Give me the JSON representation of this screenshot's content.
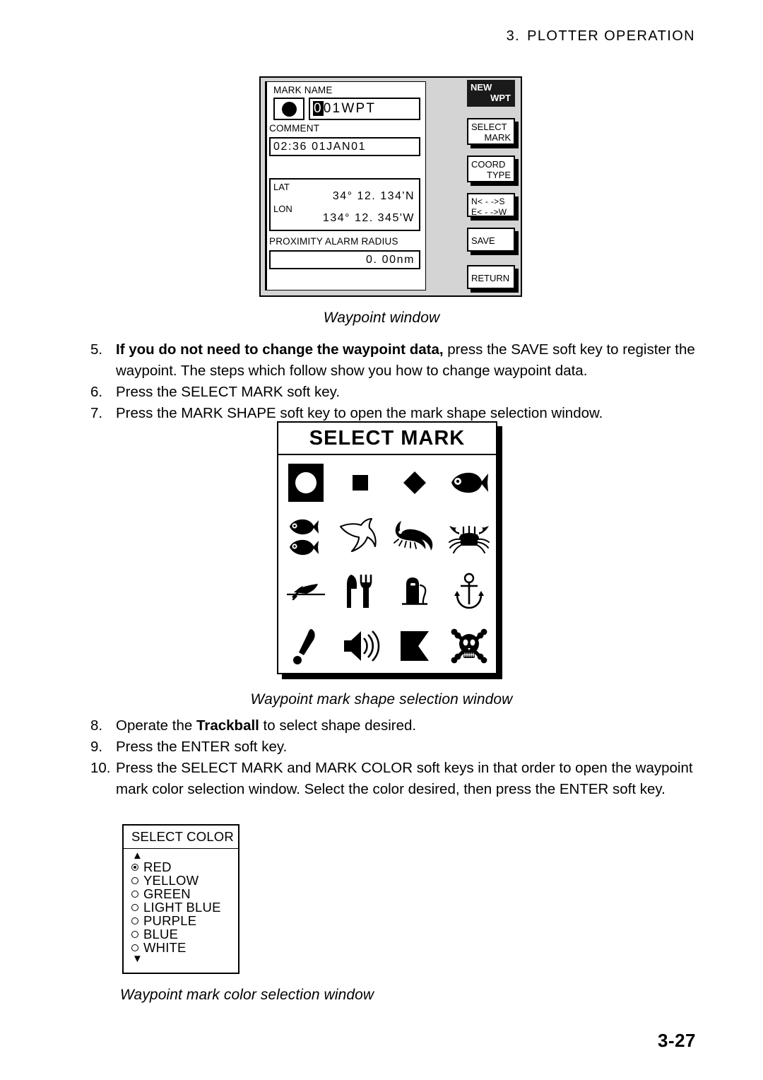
{
  "header": {
    "chapter": "3.",
    "title": "PLOTTER  OPERATION"
  },
  "page_number": "3-27",
  "waypoint_window": {
    "fields": {
      "mark_name_label": "MARK NAME",
      "mark_name_cursor_char": "0",
      "mark_name_rest": "01WPT",
      "mark_icon": "filled-circle-icon",
      "comment_label": "COMMENT",
      "comment_value": "02:36 01JAN01",
      "lat_label": "LAT",
      "lat_value": "34° 12. 134'N",
      "lon_label": "LON",
      "lon_value": "134° 12. 345'W",
      "proximity_label": "PROXIMITY ALARM RADIUS",
      "proximity_value": "0. 00nm"
    },
    "soft_keys": {
      "title_line1": "NEW",
      "title_line2": "WPT",
      "key1_line1": "SELECT",
      "key1_line2": "MARK",
      "key2_line1": "COORD",
      "key2_line2": "TYPE",
      "key3_line1": "N< - ->S",
      "key3_line2": "E< - ->W",
      "key4": "SAVE",
      "key5": "RETURN"
    },
    "caption": "Waypoint window"
  },
  "steps_a": [
    {
      "num": "5.",
      "bold": "If you do not need to change the waypoint data,",
      "text": " press the SAVE soft key to register the waypoint. The steps which follow show you how to change waypoint data."
    },
    {
      "num": "6.",
      "bold": "",
      "text": "Press the SELECT MARK soft key."
    },
    {
      "num": "7.",
      "bold": "",
      "text": "Press the MARK SHAPE soft key to open the mark shape selection window."
    }
  ],
  "select_mark_window": {
    "title": "SELECT MARK",
    "caption": "Waypoint mark shape selection window",
    "marks": [
      {
        "name": "circle-mark-icon",
        "selected": true
      },
      {
        "name": "square-mark-icon",
        "selected": false
      },
      {
        "name": "diamond-mark-icon",
        "selected": false
      },
      {
        "name": "fish-mark-icon",
        "selected": false
      },
      {
        "name": "two-fish-mark-icon",
        "selected": false
      },
      {
        "name": "dolphin-mark-icon",
        "selected": false
      },
      {
        "name": "shrimp-mark-icon",
        "selected": false
      },
      {
        "name": "crab-mark-icon",
        "selected": false
      },
      {
        "name": "wreck-mark-icon",
        "selected": false
      },
      {
        "name": "restaurant-mark-icon",
        "selected": false
      },
      {
        "name": "fuel-pump-mark-icon",
        "selected": false
      },
      {
        "name": "anchor-mark-icon",
        "selected": false
      },
      {
        "name": "exclamation-mark-icon",
        "selected": false
      },
      {
        "name": "speaker-mark-icon",
        "selected": false
      },
      {
        "name": "flag-mark-icon",
        "selected": false
      },
      {
        "name": "skull-crossbones-mark-icon",
        "selected": false
      }
    ]
  },
  "steps_b": [
    {
      "num": "8.",
      "pre": "Operate the ",
      "bold": "Trackball",
      "text": " to select shape desired."
    },
    {
      "num": "9.",
      "pre": "",
      "bold": "",
      "text": "Press the ENTER soft key."
    },
    {
      "num": "10.",
      "pre": "",
      "bold": "",
      "text": "Press the SELECT MARK and MARK COLOR soft keys in that order to open the waypoint mark color selection window. Select the color desired, then press the ENTER soft key."
    }
  ],
  "select_color_window": {
    "title": "SELECT COLOR",
    "scroll_up": "▲",
    "scroll_down": "▼",
    "caption": "Waypoint mark color selection window",
    "options": [
      {
        "label": "RED",
        "selected": true
      },
      {
        "label": "YELLOW",
        "selected": false
      },
      {
        "label": "GREEN",
        "selected": false
      },
      {
        "label": "LIGHT BLUE",
        "selected": false
      },
      {
        "label": "PURPLE",
        "selected": false
      },
      {
        "label": "BLUE",
        "selected": false
      },
      {
        "label": "WHITE",
        "selected": false
      }
    ]
  }
}
